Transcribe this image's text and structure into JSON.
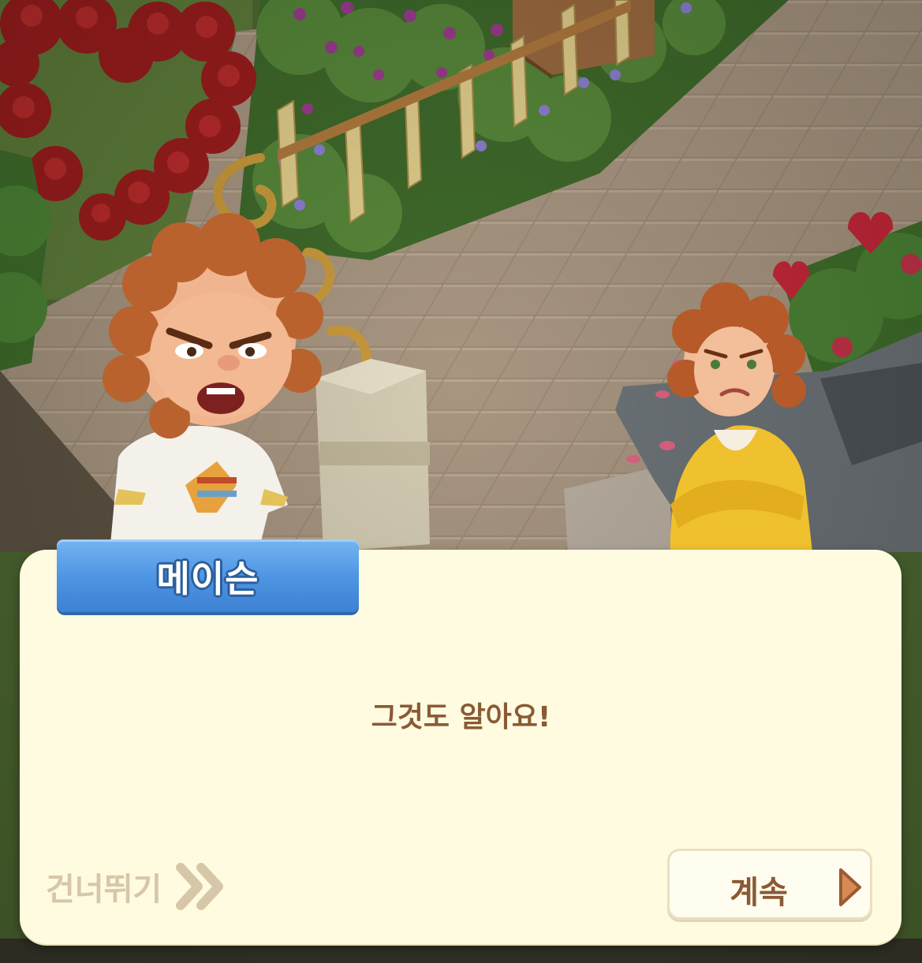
{
  "dialog": {
    "speaker": "메이슨",
    "line": "그것도 알아요!",
    "skip_label": "건너뛰기",
    "continue_label": "계속"
  },
  "icons": {
    "skip": "double-chevron-right-icon",
    "continue": "play-triangle-icon"
  },
  "colors": {
    "panel_background": "#fffbe1",
    "speaker_plate": "#4c93e2",
    "dialog_text": "#8a5a34",
    "skip_text": "#d6c7a8",
    "continue_arrow": "#d88a55"
  }
}
